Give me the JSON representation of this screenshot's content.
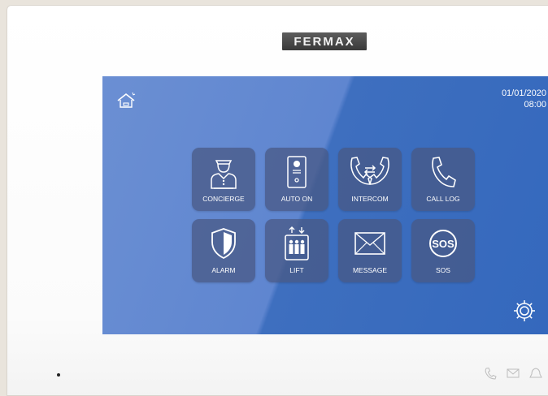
{
  "brand": {
    "logo_text": "FERMAX"
  },
  "screen": {
    "date": "01/01/2020",
    "time": "08:00",
    "home_icon": "home-icon",
    "settings_icon": "gear-icon"
  },
  "tiles": [
    {
      "label": "CONCIERGE",
      "icon": "concierge-icon"
    },
    {
      "label": "AUTO ON",
      "icon": "auto-on-icon"
    },
    {
      "label": "INTERCOM",
      "icon": "intercom-icon"
    },
    {
      "label": "CALL LOG",
      "icon": "call-log-icon"
    },
    {
      "label": "ALARM",
      "icon": "alarm-shield-icon"
    },
    {
      "label": "LIFT",
      "icon": "lift-icon"
    },
    {
      "label": "MESSAGE",
      "icon": "message-icon"
    },
    {
      "label": "SOS",
      "icon": "sos-icon"
    }
  ],
  "hardware_buttons": [
    "phone-icon",
    "envelope-icon",
    "bell-icon"
  ],
  "colors": {
    "screen_light": "#6b8fd3",
    "screen_dark": "#3468bd",
    "tile_bg": "#485882",
    "text": "#ffffff"
  }
}
